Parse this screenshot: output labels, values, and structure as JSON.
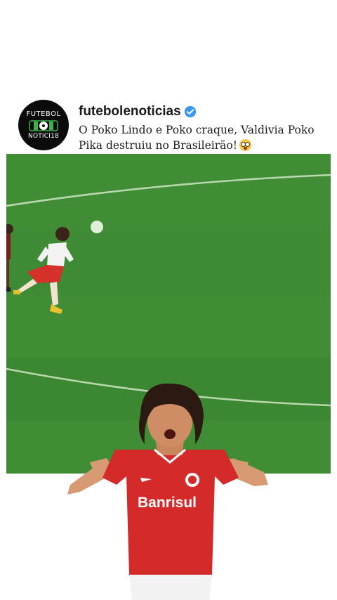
{
  "post": {
    "avatar": {
      "logo_line1": "FUTEBOL",
      "logo_line2": "NOTICI18",
      "icon": "football-ball-icon"
    },
    "handle": "futebolenoticias",
    "verified_icon": "verified-badge-icon",
    "caption": "O Poko Lindo e Poko craque, Valdivia Poko Pika destruiu no Brasileirão!",
    "caption_emoji": "flushed-face-emoji"
  },
  "video": {
    "scene": "football-match-video",
    "cutout_shirt_text": "Banrisul"
  },
  "colors": {
    "pitch": "#3d8a32",
    "kit_red": "#d42a2a",
    "avatar_bg": "#0b0b0b",
    "verified": "#3897f0"
  }
}
